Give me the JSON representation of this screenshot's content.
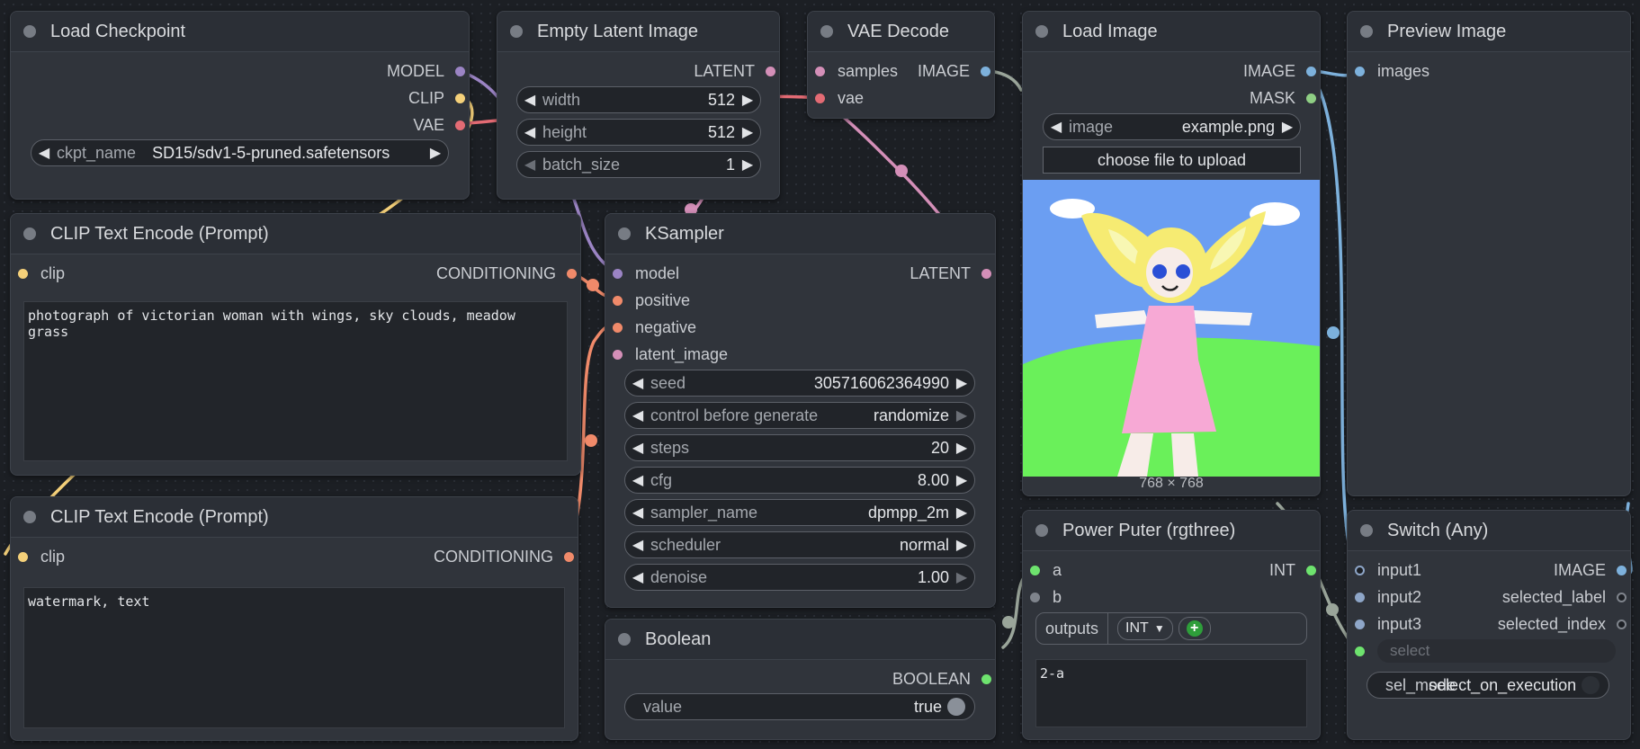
{
  "colors": {
    "model": "#9b84c4",
    "clip": "#f5d17a",
    "vae": "#e36b74",
    "conditioning": "#f08a6a",
    "latent": "#d48fb8",
    "image": "#7db1dc",
    "mask": "#8fcf84",
    "int": "#6ee36e",
    "boolean": "#6ee36e",
    "any": "#8ea6c8",
    "unlinked": "#7f848c"
  },
  "nodes": {
    "load_checkpoint": {
      "title": "Load Checkpoint",
      "outputs": [
        "MODEL",
        "CLIP",
        "VAE"
      ],
      "widget": {
        "label": "ckpt_name",
        "value": "SD15/sdv1-5-pruned.safetensors"
      }
    },
    "empty_latent": {
      "title": "Empty Latent Image",
      "output": "LATENT",
      "widgets": [
        {
          "label": "width",
          "value": "512"
        },
        {
          "label": "height",
          "value": "512"
        },
        {
          "label": "batch_size",
          "value": "1"
        }
      ]
    },
    "vae_decode": {
      "title": "VAE Decode",
      "inputs": [
        "samples",
        "vae"
      ],
      "output": "IMAGE"
    },
    "load_image": {
      "title": "Load Image",
      "outputs": [
        "IMAGE",
        "MASK"
      ],
      "widget": {
        "label": "image",
        "value": "example.png"
      },
      "upload_label": "choose file to upload",
      "dimensions": "768 × 768"
    },
    "preview_image": {
      "title": "Preview Image",
      "input": "images"
    },
    "clip_pos": {
      "title": "CLIP Text Encode (Prompt)",
      "input": "clip",
      "output": "CONDITIONING",
      "text": "photograph of victorian woman with wings, sky clouds, meadow grass"
    },
    "clip_neg": {
      "title": "CLIP Text Encode (Prompt)",
      "input": "clip",
      "output": "CONDITIONING",
      "text": "watermark, text"
    },
    "ksampler": {
      "title": "KSampler",
      "inputs": [
        "model",
        "positive",
        "negative",
        "latent_image"
      ],
      "output": "LATENT",
      "widgets": [
        {
          "label": "seed",
          "value": "305716062364990"
        },
        {
          "label": "control before generate",
          "value": "randomize"
        },
        {
          "label": "steps",
          "value": "20"
        },
        {
          "label": "cfg",
          "value": "8.00"
        },
        {
          "label": "sampler_name",
          "value": "dpmpp_2m"
        },
        {
          "label": "scheduler",
          "value": "normal"
        },
        {
          "label": "denoise",
          "value": "1.00"
        }
      ]
    },
    "boolean": {
      "title": "Boolean",
      "output": "BOOLEAN",
      "widget": {
        "label": "value",
        "value": "true"
      }
    },
    "power_puter": {
      "title": "Power Puter (rgthree)",
      "inputs": [
        "a",
        "b"
      ],
      "output": "INT",
      "outputs_label": "outputs",
      "output_type": "INT",
      "code": "2-a"
    },
    "switch_any": {
      "title": "Switch (Any)",
      "inputs": [
        "input1",
        "input2",
        "input3"
      ],
      "outputs": [
        "IMAGE",
        "selected_label",
        "selected_index"
      ],
      "select_label": "select",
      "sel_mode_label": "sel_mode",
      "sel_mode_value": "select_on_execution"
    }
  }
}
